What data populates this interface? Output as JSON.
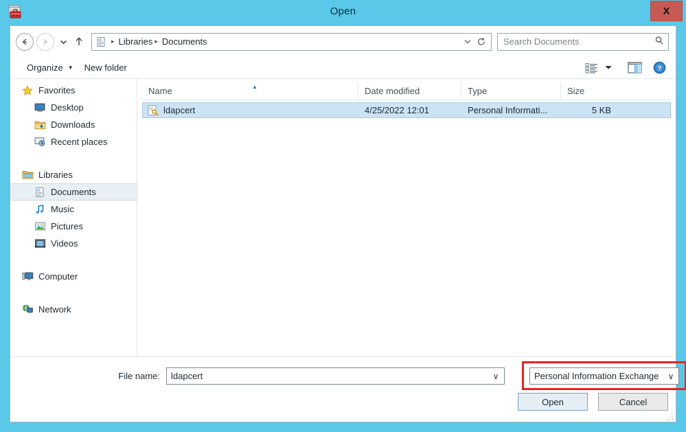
{
  "window": {
    "title": "Open",
    "app_icon": "toolbox-icon",
    "close_label": "X",
    "frame_color": "#5ac8e8",
    "close_button_color": "#c75b53"
  },
  "nav": {
    "back_icon": "back-arrow-icon",
    "forward_icon": "forward-arrow-icon",
    "history_icon": "chevron-down-icon",
    "up_icon": "up-arrow-icon",
    "address_icon": "documents-library-icon",
    "breadcrumbs": [
      "Libraries",
      "Documents"
    ],
    "separator": "▸",
    "dropdown_icon": "chevron-down-icon",
    "refresh_icon": "refresh-icon"
  },
  "search": {
    "placeholder": "Search Documents",
    "value": "",
    "icon": "search-icon"
  },
  "toolbar": {
    "organize_label": "Organize",
    "organize_caret": "▼",
    "new_folder_label": "New folder",
    "view_icon": "list-view-icon",
    "view_caret": "▼",
    "preview_pane_icon": "preview-pane-icon",
    "help_icon": "help-icon"
  },
  "sidebar": {
    "groups": [
      {
        "header": {
          "label": "Favorites",
          "icon": "star-icon"
        },
        "items": [
          {
            "label": "Desktop",
            "icon": "desktop-icon"
          },
          {
            "label": "Downloads",
            "icon": "downloads-folder-icon"
          },
          {
            "label": "Recent places",
            "icon": "recent-places-icon"
          }
        ]
      },
      {
        "header": {
          "label": "Libraries",
          "icon": "libraries-folder-icon"
        },
        "items": [
          {
            "label": "Documents",
            "icon": "documents-library-icon",
            "selected": true
          },
          {
            "label": "Music",
            "icon": "music-library-icon"
          },
          {
            "label": "Pictures",
            "icon": "pictures-library-icon"
          },
          {
            "label": "Videos",
            "icon": "videos-library-icon"
          }
        ]
      },
      {
        "header": {
          "label": "Computer",
          "icon": "computer-icon"
        },
        "items": []
      },
      {
        "header": {
          "label": "Network",
          "icon": "network-icon"
        },
        "items": []
      }
    ]
  },
  "file_list": {
    "columns": [
      {
        "label": "Name",
        "sorted": "asc",
        "sort_arrow": "▲"
      },
      {
        "label": "Date modified"
      },
      {
        "label": "Type"
      },
      {
        "label": "Size"
      }
    ],
    "rows": [
      {
        "name": "ldapcert",
        "icon": "certificate-file-icon",
        "date_modified": "4/25/2022 12:01",
        "type": "Personal Informati...",
        "size": "5 KB",
        "selected": true
      }
    ],
    "selection_color": "#cce3f5"
  },
  "bottom": {
    "filename_label": "File name:",
    "filename_value": "ldapcert",
    "filename_caret": "∨",
    "filetype_value": "Personal Information Exchange",
    "filetype_caret": "∨",
    "open_label": "Open",
    "cancel_label": "Cancel",
    "highlight_color": "#e8241d"
  }
}
